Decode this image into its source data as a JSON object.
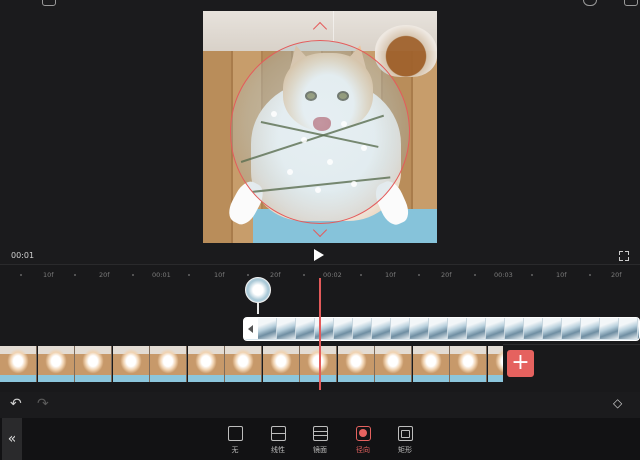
{
  "player": {
    "timecode": "00:01"
  },
  "ruler": {
    "ticks": [
      "10f",
      "20f",
      "00:01",
      "10f",
      "20f",
      "00:02",
      "10f",
      "20f",
      "00:03",
      "10f",
      "20f"
    ]
  },
  "timeline": {
    "add_clip_label": "+"
  },
  "toolbar": {
    "collapse_label": "«",
    "undo_label": "↶",
    "redo_label": "↷",
    "keyframe_label": "◇",
    "mask_options": [
      {
        "label": "无",
        "icon": "none-mask-icon",
        "selected": false
      },
      {
        "label": "线性",
        "icon": "linear-mask-icon",
        "selected": false
      },
      {
        "label": "镜面",
        "icon": "mirror-mask-icon",
        "selected": false
      },
      {
        "label": "径向",
        "icon": "radial-mask-icon",
        "selected": true
      },
      {
        "label": "矩形",
        "icon": "rectangle-mask-icon",
        "selected": false
      }
    ]
  },
  "colors": {
    "accent": "#e5625f",
    "background": "#1b1b1d",
    "toolbar_bg": "#121214"
  }
}
